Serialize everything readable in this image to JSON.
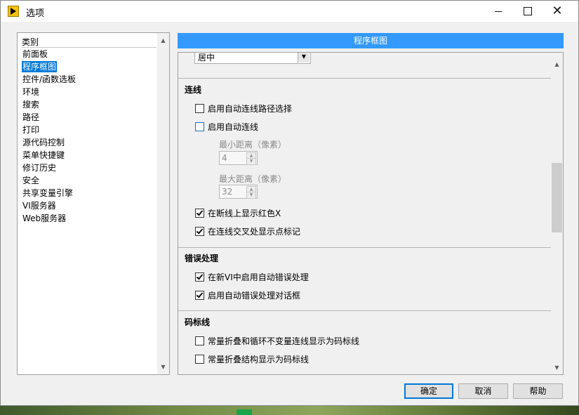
{
  "window": {
    "title": "选项"
  },
  "categories": {
    "header": "类别",
    "items": [
      "前面板",
      "程序框图",
      "控件/函数选板",
      "环境",
      "搜索",
      "路径",
      "打印",
      "源代码控制",
      "菜单快捷键",
      "修订历史",
      "安全",
      "共享变量引擎",
      "VI服务器",
      "Web服务器"
    ],
    "selected": "程序框图"
  },
  "section_title": "程序框图",
  "partial_dropdown_value": "居中",
  "wiring": {
    "title": "连线",
    "auto_route": {
      "label": "启用自动连线路径选择",
      "checked": false
    },
    "auto_wire": {
      "label": "启用自动连线",
      "checked": false
    },
    "min_distance": {
      "label": "最小距离（像素）",
      "value": "4"
    },
    "max_distance": {
      "label": "最大距离（像素）",
      "value": "32"
    },
    "red_x": {
      "label": "在断线上显示红色X",
      "checked": true
    },
    "dots": {
      "label": "在连线交叉处显示点标记",
      "checked": true
    }
  },
  "error_handling": {
    "title": "错误处理",
    "new_vi_auto": {
      "label": "在新VI中启用自动错误处理",
      "checked": true
    },
    "auto_dialog": {
      "label": "启用自动错误处理对话框",
      "checked": true
    }
  },
  "code_lines": {
    "title": "码标线",
    "fold_loop": {
      "label": "常量折叠和循环不变量连线显示为码标线",
      "checked": false
    },
    "fold_struct": {
      "label": "常量折叠结构显示为码标线",
      "checked": false
    }
  },
  "buttons": {
    "ok": "确定",
    "cancel": "取消",
    "help": "帮助"
  },
  "icons": [
    "labview-app-icon",
    "minimize-icon",
    "maximize-icon",
    "close-icon",
    "scroll-up-icon",
    "scroll-down-icon",
    "dropdown-arrow-icon",
    "spin-up-icon",
    "spin-down-icon"
  ]
}
